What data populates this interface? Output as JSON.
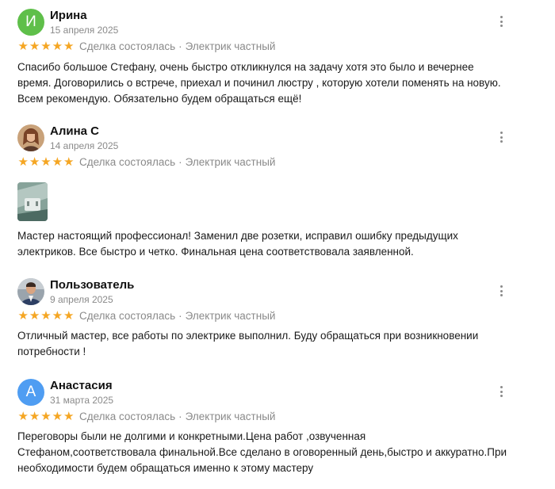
{
  "reviews": [
    {
      "name": "Ирина",
      "date": "15 апреля 2025",
      "avatar_letter": "И",
      "deal": "Сделка состоялась",
      "separator": "·",
      "category": "Электрик частный",
      "rating": 5,
      "text": "Спасибо большое Стефану, очень быстро откликнулся на задачу хотя это было и вечернее время. Договорились о встрече, приехал и починил люстру , которую хотели поменять на новую. Всем рекомендую. Обязательно будем обращаться ещё!"
    },
    {
      "name": "Алина С",
      "date": "14 апреля 2025",
      "deal": "Сделка состоялась",
      "separator": "·",
      "category": "Электрик частный",
      "rating": 5,
      "text": "Мастер настоящий профессионал! Заменил две розетки, исправил ошибку предыдущих электриков. Все быстро и четко. Финальная цена соответствовала заявленной."
    },
    {
      "name": "Пользователь",
      "date": "9 апреля 2025",
      "deal": "Сделка состоялась",
      "separator": "·",
      "category": "Электрик частный",
      "rating": 5,
      "text": "Отличный мастер, все работы по электрике выполнил. Буду обращаться при возникновении потребности !"
    },
    {
      "name": "Анастасия",
      "date": "31 марта 2025",
      "avatar_letter": "А",
      "deal": "Сделка состоялась",
      "separator": "·",
      "category": "Электрик частный",
      "rating": 5,
      "text": "Переговоры были не долгими и конкретными.Цена работ ,озвученная Стефаном,соответствовала финальной.Все сделано в оговоренный день,быстро и аккуратно.При необходимости будем обращаться именно к этому мастеру"
    }
  ],
  "colors": {
    "star": "#f5a623",
    "muted": "#8a8a8a",
    "avatar_green": "#5fbf4a",
    "avatar_blue": "#4f9df2"
  }
}
